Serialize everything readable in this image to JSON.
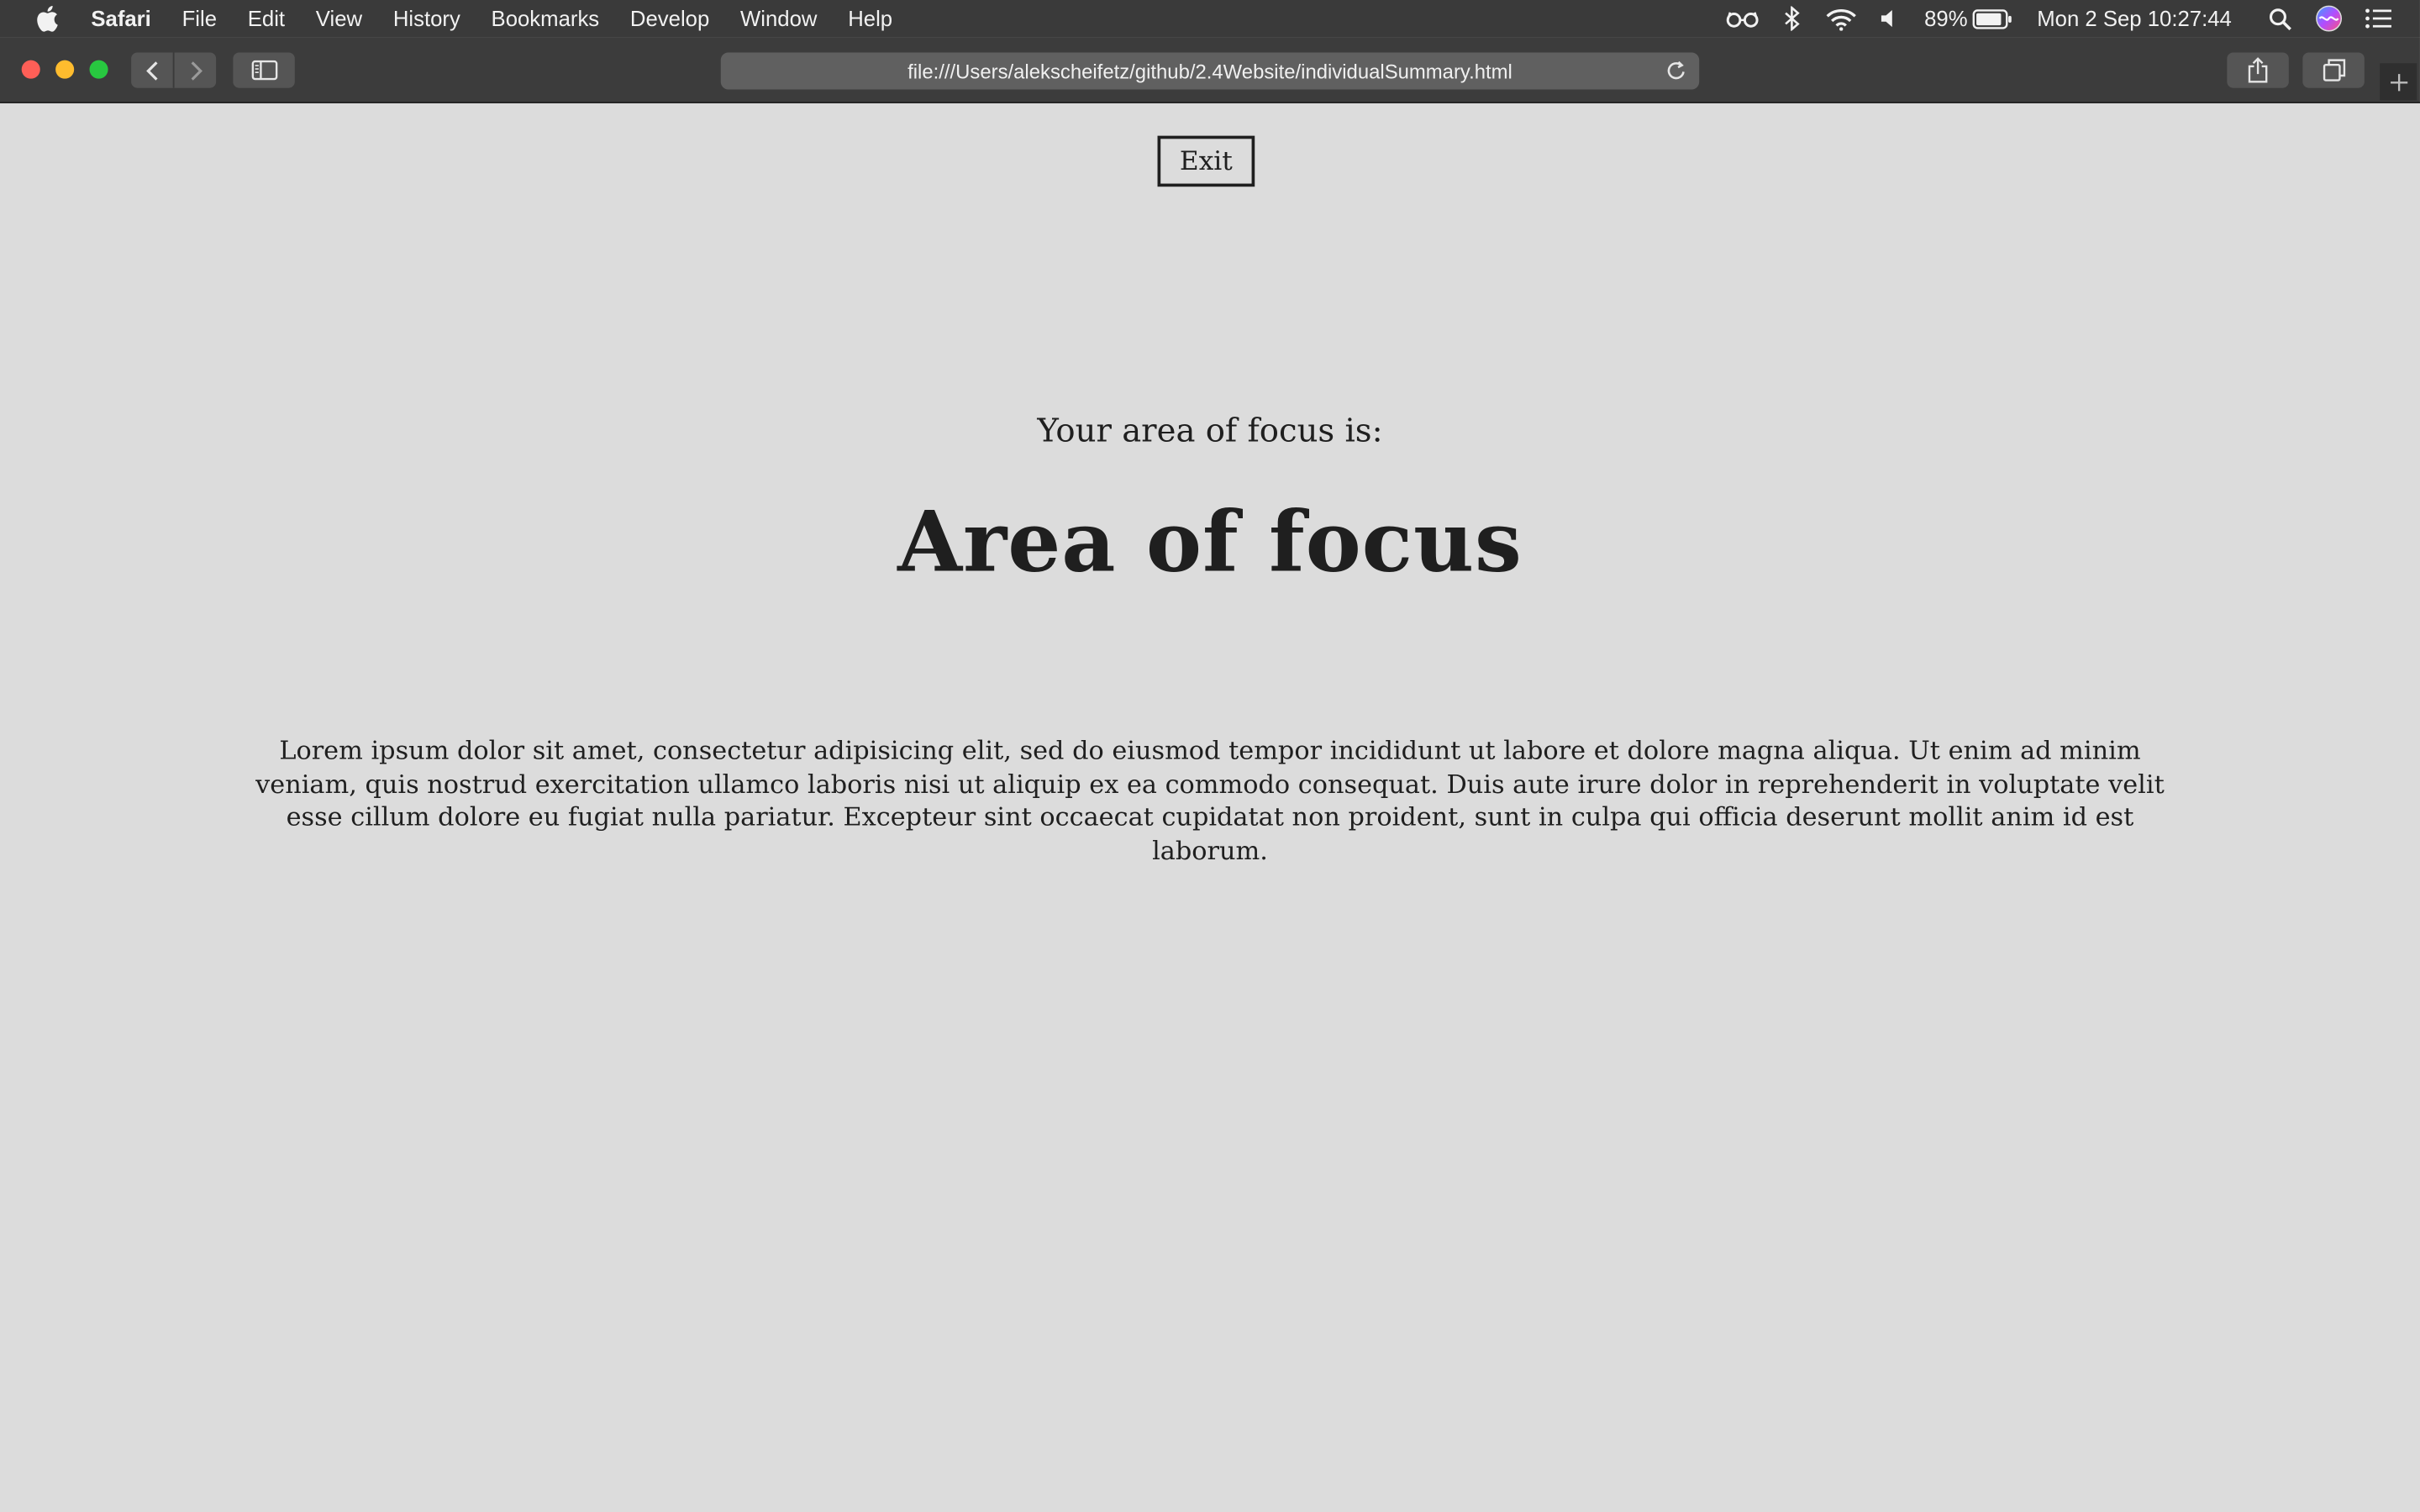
{
  "menubar": {
    "apple_icon": "apple-icon",
    "app_name": "Safari",
    "items": [
      "File",
      "Edit",
      "View",
      "History",
      "Bookmarks",
      "Develop",
      "Window",
      "Help"
    ],
    "status": {
      "battery_percent": "89%",
      "datetime": "Mon 2 Sep  10:27:44"
    }
  },
  "toolbar": {
    "url": "file:///Users/alekscheifetz/github/2.4Website/individualSummary.html"
  },
  "page": {
    "exit_label": "Exit",
    "subtitle": "Your area of focus is:",
    "title": "Area of focus",
    "body": "Lorem ipsum dolor sit amet, consectetur adipisicing elit, sed do eiusmod tempor incididunt ut labore et dolore magna aliqua. Ut enim ad minim veniam, quis nostrud exercitation ullamco laboris nisi ut aliquip ex ea commodo consequat. Duis aute irure dolor in reprehenderit in voluptate velit esse cillum dolore eu fugiat nulla pariatur. Excepteur sint occaecat cupidatat non proident, sunt in culpa qui officia deserunt mollit anim id est laborum."
  },
  "colors": {
    "page_background": "#dcdcdc",
    "text": "#1f1f1f",
    "toolbar": "#3c3c3c",
    "menubar": "#3a3a3a"
  }
}
